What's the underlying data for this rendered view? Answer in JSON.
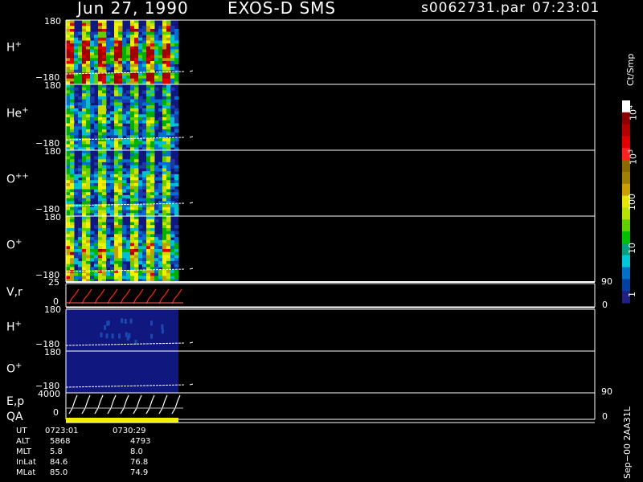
{
  "header": {
    "date": "Jun 27, 1990",
    "mission": "EXOS-D SMS",
    "file": "s0062731.par",
    "time": "07:23:01"
  },
  "panels": [
    {
      "label": "H",
      "sup": "+",
      "top": "180",
      "bottom": "−180"
    },
    {
      "label": "He",
      "sup": "+",
      "top": "180",
      "bottom": "−180"
    },
    {
      "label": "O",
      "sup": "++",
      "top": "180",
      "bottom": "−180"
    },
    {
      "label": "O",
      "sup": "+",
      "top": "180",
      "bottom": "−180"
    },
    {
      "label": "V,r",
      "sup": "",
      "top": "25",
      "bottom": "0",
      "right_top": "90",
      "right_bottom": "0"
    },
    {
      "label": "H",
      "sup": "+",
      "top": "180",
      "bottom": "−180"
    },
    {
      "label": "O",
      "sup": "+",
      "top": "180",
      "bottom": "−180"
    },
    {
      "label": "E,p",
      "sup": "",
      "top": "4000",
      "bottom": "0",
      "right_top": "90",
      "right_bottom": "0"
    }
  ],
  "qa_label": "QA",
  "colorbar": {
    "unit": "Ct/Smp",
    "ticks": [
      "10",
      "100",
      "10",
      "10",
      "1"
    ],
    "tick_sups": [
      "4",
      "",
      "3",
      "",
      ""
    ],
    "colors": [
      "#ffffff",
      "#8b0000",
      "#b00000",
      "#e00000",
      "#ff2020",
      "#8a6a00",
      "#a08000",
      "#c8a000",
      "#e6e600",
      "#b8e000",
      "#60d000",
      "#00c000",
      "#00a080",
      "#00c8d8",
      "#0070c8",
      "#0040a0",
      "#202080"
    ]
  },
  "side_note": "Sep−00 2AA31L",
  "ephemeris": {
    "rows": [
      {
        "name": "UT",
        "v1": "0723:01",
        "v2": "0730:29"
      },
      {
        "name": "ALT",
        "v1": "5868",
        "v2": "4793"
      },
      {
        "name": "MLT",
        "v1": "5.8",
        "v2": "8.0"
      },
      {
        "name": "InLat",
        "v1": "84.6",
        "v2": "76.8"
      },
      {
        "name": "MLat",
        "v1": "85.0",
        "v2": "74.9"
      }
    ]
  },
  "chart_data": {
    "type": "heatmap",
    "title": "Jun 27, 1990   EXOS-D SMS",
    "colorbar_label": "Ct/Smp",
    "colorbar_ticks": [
      "1",
      "10",
      "100",
      "10^3",
      "10^4"
    ],
    "pitch_angle_range": [
      -180,
      180
    ],
    "vr_range": [
      0,
      25
    ],
    "ep_range": [
      0,
      4000
    ],
    "ut_range": [
      "0723:01",
      "0730:29"
    ]
  }
}
